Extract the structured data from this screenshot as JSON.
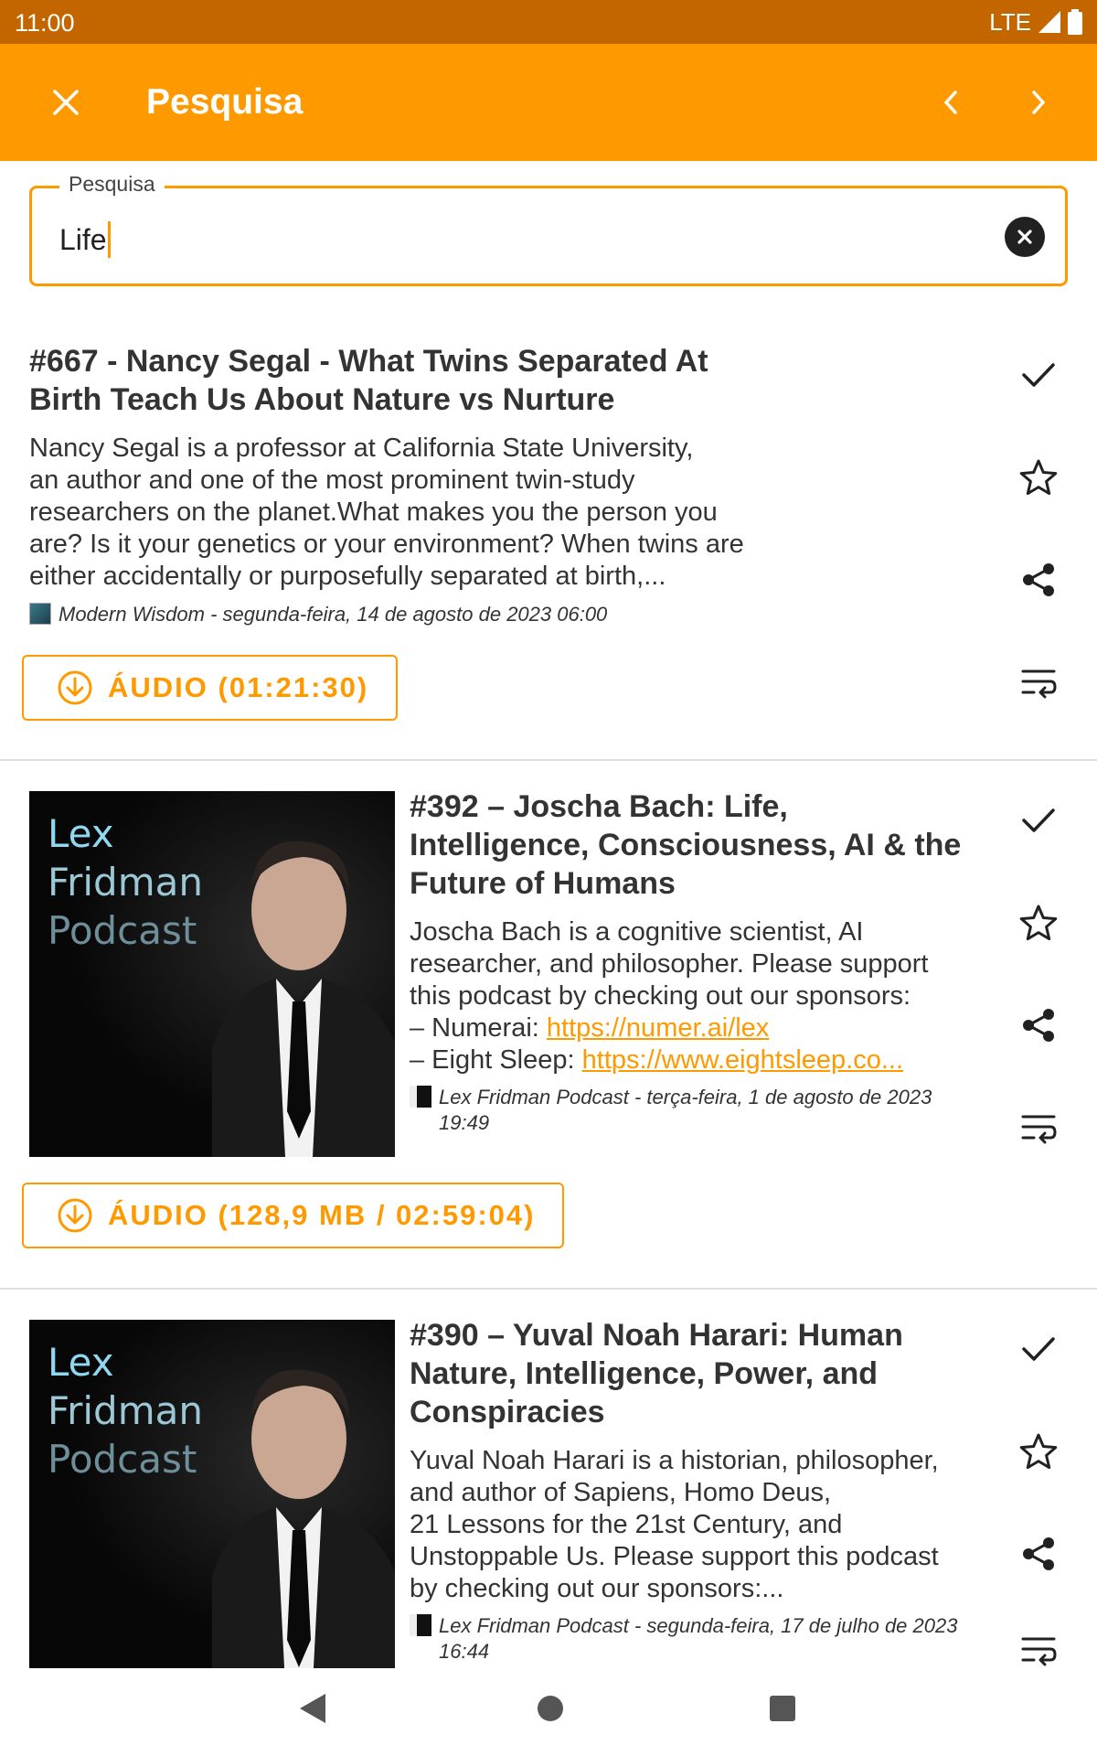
{
  "status_bar": {
    "time": "11:00",
    "network": "LTE"
  },
  "app_bar": {
    "title": "Pesquisa"
  },
  "search": {
    "label": "Pesquisa",
    "value": "Life"
  },
  "results": [
    {
      "title_line1": "#667 - Nancy Segal - What Twins Separated At",
      "title_line2": "Birth Teach Us About Nature vs Nurture",
      "desc_lines": [
        "Nancy Segal is a professor at California State University,",
        "an author and one of the most prominent twin-study",
        "researchers on the planet.What makes you the person you",
        "are? Is it your genetics or your environment? When twins are",
        "either accidentally or purposefully separated at birth,..."
      ],
      "meta": "Modern Wisdom - segunda-feira, 14 de agosto de 2023 06:00",
      "audio_label": "ÁUDIO (01:21:30)"
    },
    {
      "title_line1": "#392 – Joscha Bach: Life,",
      "title_line2": "Intelligence, Consciousness, AI & the",
      "title_line3": "Future of Humans",
      "desc_lines": [
        "Joscha Bach is a cognitive scientist, AI",
        "researcher, and philosopher. Please support",
        "this podcast by checking out our sponsors:"
      ],
      "sponsor1_prefix": "– Numerai: ",
      "sponsor1_link": "https://numer.ai/lex",
      "sponsor2_prefix": "– Eight Sleep: ",
      "sponsor2_link": "https://www.eightsleep.co...",
      "meta_line1": "Lex Fridman Podcast - terça-feira, 1 de agosto de 2023",
      "meta_line2": "19:49",
      "cover": {
        "line1": "Lex",
        "line2": "Fridman",
        "line3": "Podcast"
      },
      "audio_label": "ÁUDIO (128,9 MB / 02:59:04)"
    },
    {
      "title_line1": "#390 – Yuval Noah Harari: Human",
      "title_line2": "Nature, Intelligence, Power, and",
      "title_line3": "Conspiracies",
      "desc_lines": [
        "Yuval Noah Harari is a historian, philosopher,",
        "and author of Sapiens, Homo Deus,",
        "21 Lessons for the 21st Century, and",
        "Unstoppable Us. Please support this podcast",
        "by checking out our sponsors:..."
      ],
      "meta_line1": "Lex Fridman Podcast - segunda-feira, 17 de julho de 2023",
      "meta_line2": "16:44",
      "cover": {
        "line1": "Lex",
        "line2": "Fridman",
        "line3": "Podcast"
      }
    }
  ],
  "icons": {
    "close": "close-icon",
    "prev": "chevron-left-icon",
    "next": "chevron-right-icon",
    "clear": "clear-icon",
    "played": "check-icon",
    "favorite": "star-outline-icon",
    "share": "share-icon",
    "queue": "playlist-add-icon",
    "download": "download-circle-icon"
  },
  "colors": {
    "accent": "#ff9900",
    "status_bar": "#c46600",
    "text": "#212121"
  }
}
